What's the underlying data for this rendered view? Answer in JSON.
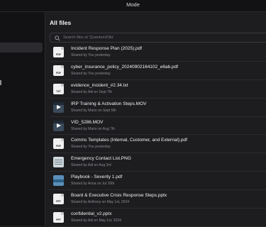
{
  "topbar": {
    "title": "Mode"
  },
  "page": {
    "heading": "All files"
  },
  "search": {
    "placeholder": "Search files at 'QuantumZilla'"
  },
  "files": [
    {
      "name": "Incident Response Plan (2025).pdf",
      "meta": "Shared by You yesterday",
      "kind": "doc",
      "ext": "PDF"
    },
    {
      "name": "cyber_insurance_policy_20240902164102_e6ab.pdf",
      "meta": "Shared by You yesterday",
      "kind": "doc",
      "ext": "PDF"
    },
    {
      "name": "evidence_incident_#2.34.txt",
      "meta": "Shared by Adi on Sept 7th",
      "kind": "doc",
      "ext": "TXT"
    },
    {
      "name": "IRP Training & Activation Steps.MOV",
      "meta": "Shared by Mario on Sept 5th",
      "kind": "video",
      "ext": ""
    },
    {
      "name": "VID_5286.MOV",
      "meta": "Shared by Mario on Aug 7th",
      "kind": "video",
      "ext": ""
    },
    {
      "name": "Comms Templates (Internal, Customer, and External).pdf",
      "meta": "Shared by You yesterday",
      "kind": "doc",
      "ext": "PDF"
    },
    {
      "name": "Emergency Contact List.PNG",
      "meta": "Shared by Adi on Aug 3rd",
      "kind": "image",
      "ext": ""
    },
    {
      "name": "Playbook - Severity 1.pdf",
      "meta": "Shared by Anna on Jul 20th",
      "kind": "pdfblue",
      "ext": ""
    },
    {
      "name": "Board & Executive Crisis Response Steps.pptx",
      "meta": "Shared by Anthony on May 1st, 2024",
      "kind": "doc",
      "ext": "PPT"
    },
    {
      "name": "confidential_v2.pptx",
      "meta": "Shared by Adi on May 1st, 2024",
      "kind": "doc",
      "ext": "PPT"
    }
  ]
}
